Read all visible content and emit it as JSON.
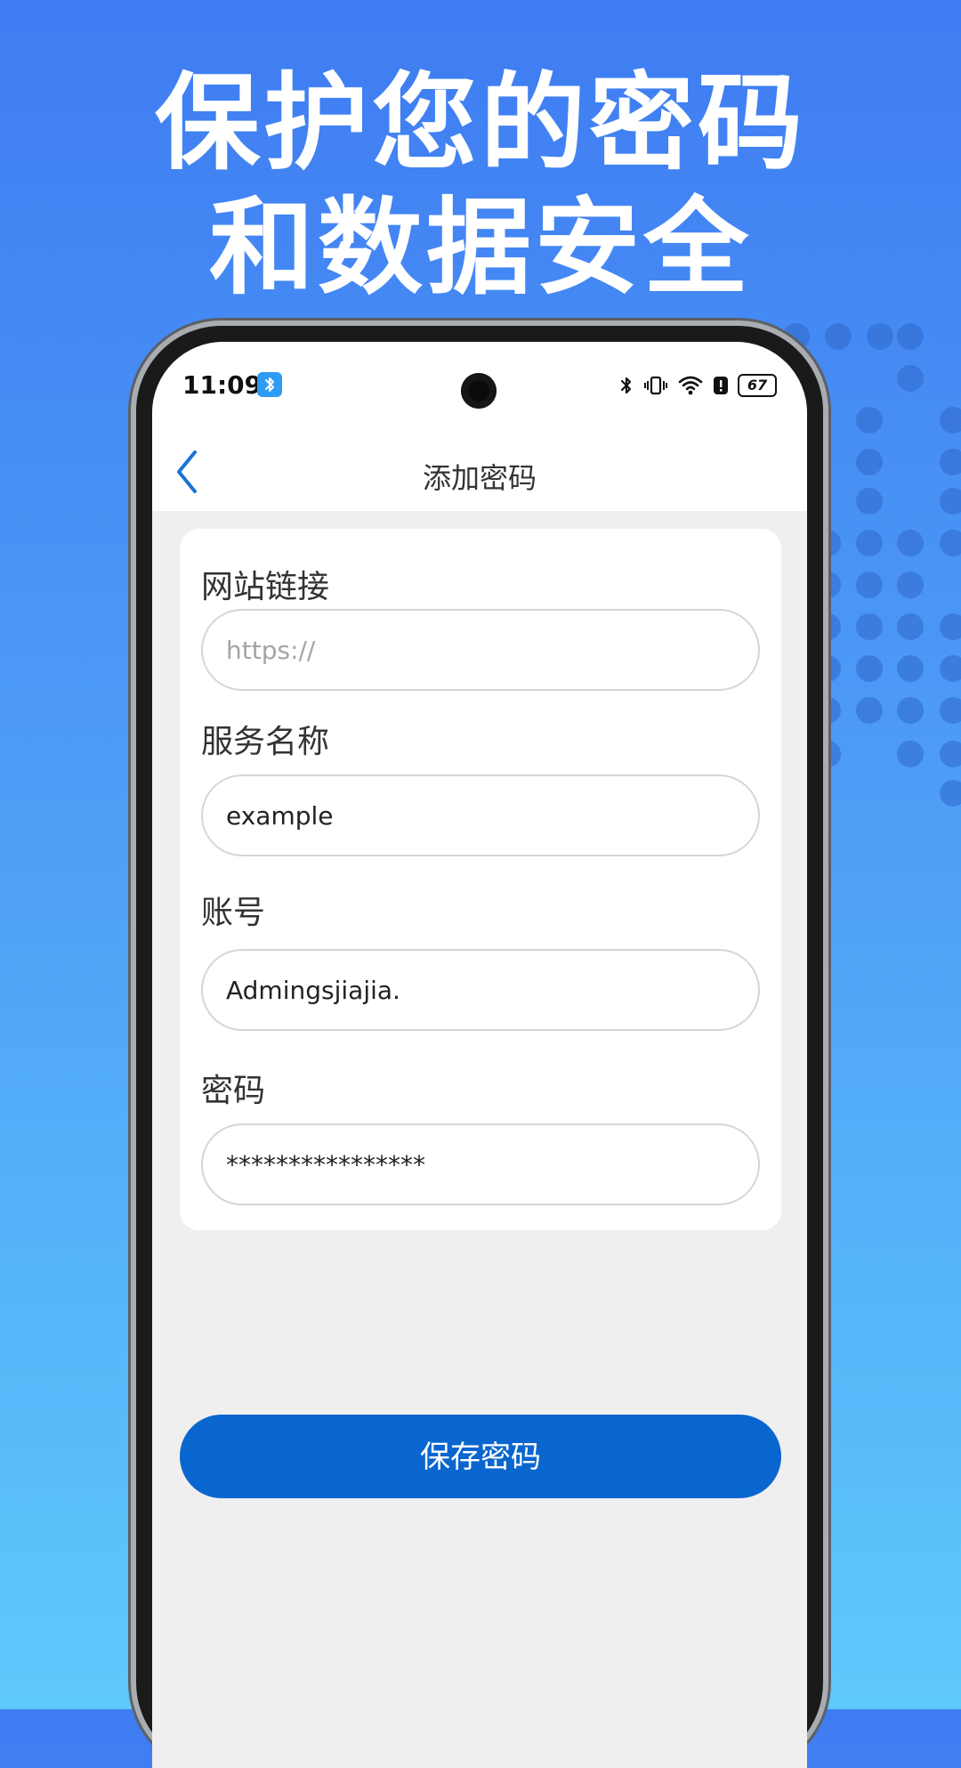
{
  "headline": {
    "line1": "保护您的密码",
    "line2": "和数据安全"
  },
  "status_bar": {
    "time": "11:09",
    "battery": "67",
    "bt_badge_icon": "bluetooth-icon"
  },
  "header": {
    "title": "添加密码",
    "back_icon": "chevron-left-icon"
  },
  "form": {
    "url": {
      "label": "网站链接",
      "placeholder": "https://",
      "value": ""
    },
    "service": {
      "label": "服务名称",
      "value": "example"
    },
    "account": {
      "label": "账号",
      "value": "Admingsjiajia."
    },
    "password": {
      "label": "密码",
      "value": "****************"
    }
  },
  "save_button": {
    "label": "保存密码"
  },
  "colors": {
    "accent": "#0a66cf",
    "background_top": "#3f7cf2",
    "background_bottom": "#5ec9fb"
  }
}
